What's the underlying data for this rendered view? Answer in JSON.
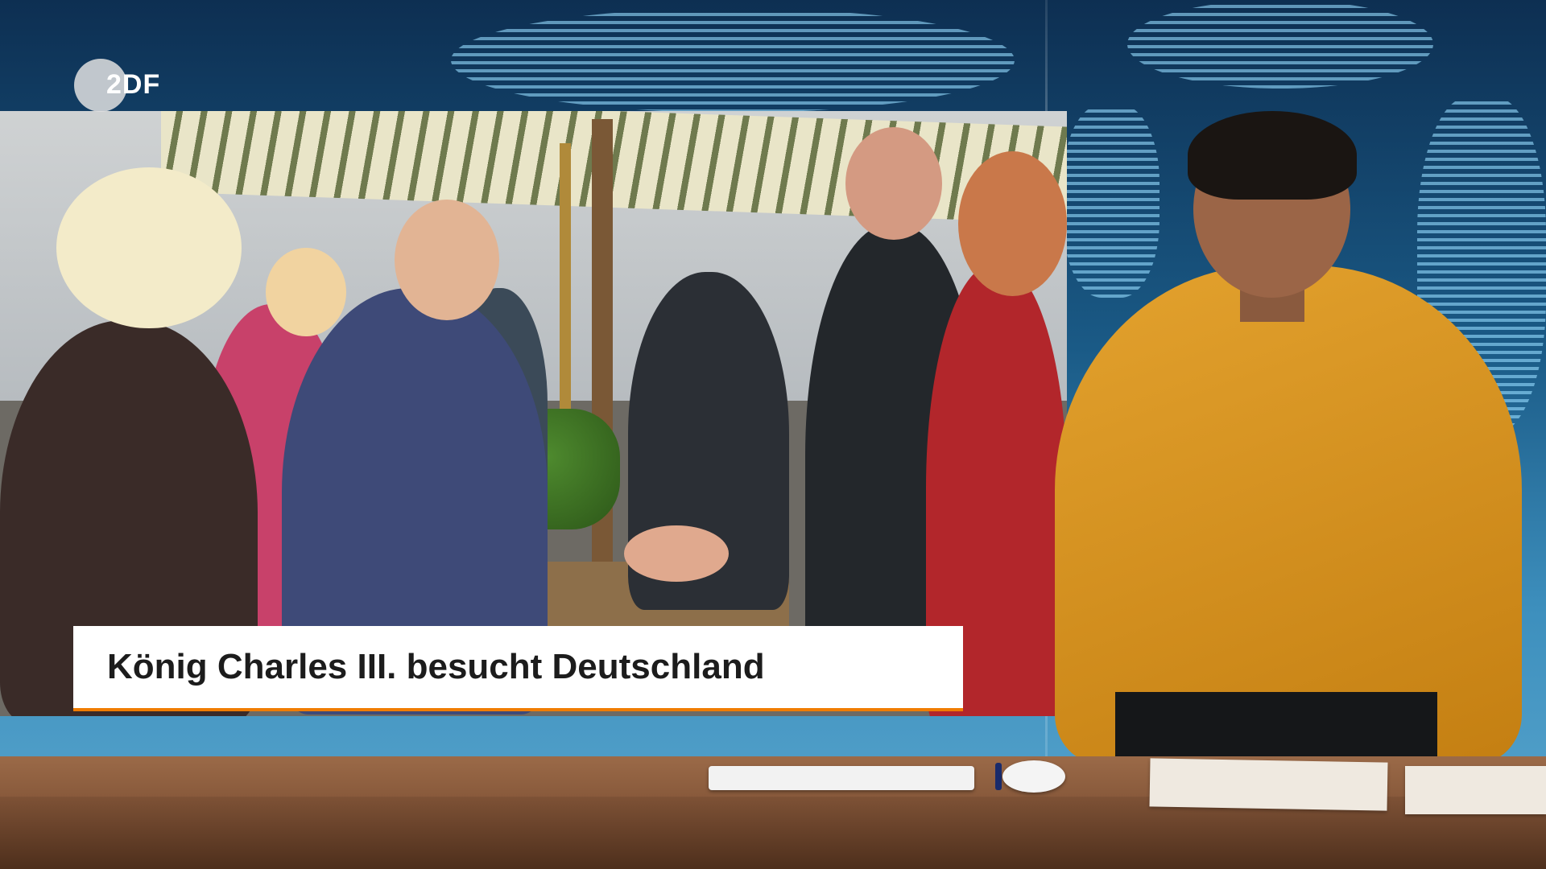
{
  "channel": {
    "logo_text": "2DF"
  },
  "lower_third": {
    "headline": "König Charles III. besucht Deutschland"
  },
  "colors": {
    "accent": "#f07c00",
    "headline_text": "#1c1c1c",
    "lower_third_bg": "#ffffff"
  }
}
